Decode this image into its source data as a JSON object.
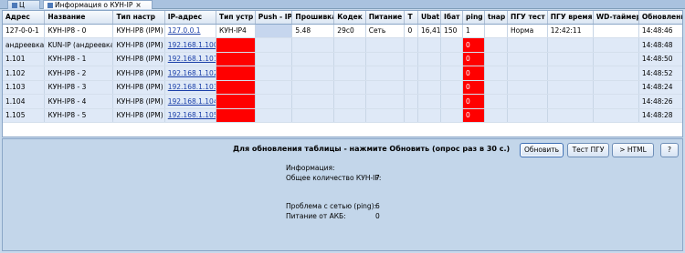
{
  "tabs": [
    {
      "label": "Ц"
    },
    {
      "label": "Информация о КУН-IP"
    }
  ],
  "columns": [
    "Адрес",
    "Название",
    "Тип настр",
    "IP-адрес",
    "Тип устр",
    "Push - IP",
    "Прошивка",
    "Кодек",
    "Питание",
    "T",
    "Ubat",
    "Ібат",
    "ping",
    "tнар",
    "ПГУ тест",
    "ПГУ время",
    "WD-таймер",
    "Обновление"
  ],
  "rows": [
    [
      "127-0-0-1",
      "КУН-IP8 - 0",
      "КУН-IP8 (IPM)",
      "127.0.0.1",
      "КУН-IP4",
      "",
      "5.48",
      "29c0",
      "Сеть",
      "0",
      "16,41",
      "150",
      "1",
      "",
      "Норма",
      "12:42:11",
      "",
      "14:48:46"
    ],
    [
      "андреевка",
      "KUN-IP (андреевка)",
      "КУН-IP8 (IPM)",
      "192.168.1.100",
      "",
      "",
      "",
      "",
      "",
      "",
      "",
      "",
      "0",
      "",
      "",
      "",
      "",
      "14:48:48"
    ],
    [
      "1.101",
      "КУН-IP8 - 1",
      "КУН-IP8 (IPM)",
      "192.168.1.101",
      "",
      "",
      "",
      "",
      "",
      "",
      "",
      "",
      "0",
      "",
      "",
      "",
      "",
      "14:48:50"
    ],
    [
      "1.102",
      "КУН-IP8 - 2",
      "КУН-IP8 (IPM)",
      "192.168.1.102",
      "",
      "",
      "",
      "",
      "",
      "",
      "",
      "",
      "0",
      "",
      "",
      "",
      "",
      "14:48:52"
    ],
    [
      "1.103",
      "КУН-IP8 - 3",
      "КУН-IP8 (IPM)",
      "192.168.1.103",
      "",
      "",
      "",
      "",
      "",
      "",
      "",
      "",
      "0",
      "",
      "",
      "",
      "",
      "14:48:24"
    ],
    [
      "1.104",
      "КУН-IP8 - 4",
      "КУН-IP8 (IPM)",
      "192.168.1.104",
      "",
      "",
      "",
      "",
      "",
      "",
      "",
      "",
      "0",
      "",
      "",
      "",
      "",
      "14:48:26"
    ],
    [
      "1.105",
      "КУН-IP8 - 5",
      "КУН-IP8 (IPM)",
      "192.168.1.105",
      "",
      "",
      "",
      "",
      "",
      "",
      "",
      "",
      "0",
      "",
      "",
      "",
      "",
      "14:48:28"
    ]
  ],
  "colors": {
    "offline": "#ff0000",
    "selected": "#c6d6ee"
  },
  "hint": "Для обновления таблицы  - нажмите Обновить (опрос раз в 30 с.)",
  "buttons": {
    "refresh": "Обновить",
    "test": "Тест ПГУ",
    "html": "> HTML",
    "help": "?"
  },
  "info": {
    "title": "Информация:",
    "total_label": "Общее количество КУН-IP:",
    "total_value": "7",
    "ping_label": "Проблема с сетью (ping):",
    "ping_value": "6",
    "battery_label": "Питание от АКБ:",
    "battery_value": "0"
  }
}
